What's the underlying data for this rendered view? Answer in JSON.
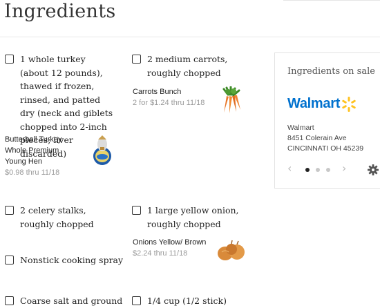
{
  "section": {
    "title": "Ingredients"
  },
  "ingredients": [
    {
      "text": "1 whole turkey (about 12 pounds), thawed if frozen, rinsed, and patted dry (neck and giblets chopped into 2-inch pieces; liver discarded)"
    },
    {
      "text": "2 medium carrots, roughly chopped"
    },
    {
      "text": "2 celery stalks, roughly chopped"
    },
    {
      "text": "1 large yellow onion, roughly chopped"
    },
    {
      "text": "Nonstick cooking spray"
    },
    {
      "text": "Coarse salt and ground"
    },
    {
      "text": "1/4 cup (1/2 stick)"
    }
  ],
  "deals": [
    {
      "name": "Butterball Turkey Whole Premium Young Hen",
      "price": "$0.98 thru 11/18",
      "icon": "turkey-package-icon"
    },
    {
      "name": "Carrots Bunch",
      "price": "2 for $1.24 thru 11/18",
      "icon": "carrots-icon"
    },
    {
      "name": "Onions Yellow/ Brown",
      "price": "$2.24 thru 11/18",
      "icon": "onions-icon"
    }
  ],
  "sale_card": {
    "title": "Ingredients on sale",
    "store_logo": "Walmart",
    "store_name": "Walmart",
    "store_address": "8451 Colerain Ave",
    "store_city": "CINCINNATI OH 45239",
    "carousel_pages": 3,
    "active_page": 1,
    "colors": {
      "walmart_blue": "#0071ce",
      "walmart_yellow": "#ffc220"
    }
  }
}
